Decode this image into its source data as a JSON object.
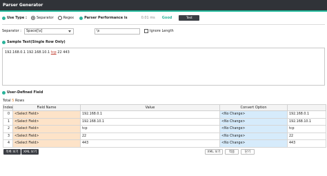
{
  "window": {
    "title": "Parser Generator"
  },
  "use_type": {
    "label": "Use Type :",
    "options": [
      {
        "label": "Separator",
        "checked": true
      },
      {
        "label": "Regex",
        "checked": false
      }
    ]
  },
  "performance": {
    "label": "Parser Performance is",
    "value": "0.01 ms",
    "status": "Good",
    "test_label": "Test"
  },
  "separator": {
    "label": "Separator :",
    "selected": "Space[\\s]",
    "input_value": "\\s",
    "ignore_length_label": "Ignore Length"
  },
  "sample": {
    "label": "Sample Text(Single Row Only)",
    "text_before": "192.168.0.1 192.168.10.1 ",
    "text_highlight": "tcp",
    "text_after": " 22 443"
  },
  "user_defined": {
    "label": "User-Defined Field",
    "total_prefix": "Total ",
    "total_count": "5",
    "total_suffix": " Rows",
    "columns": [
      "Index",
      "Field Name",
      "Value",
      "Convert Option",
      ""
    ],
    "rows": [
      [
        "0",
        "<Select Field>",
        "192.168.0.1",
        "<No Change>",
        "192.168.0.1"
      ],
      [
        "1",
        "<Select Field>",
        "192.168.10.1",
        "<No Change>",
        "192.168.10.1"
      ],
      [
        "2",
        "<Select Field>",
        "tcp",
        "<No Change>",
        "tcp"
      ],
      [
        "3",
        "<Select Field>",
        "22",
        "<No Change>",
        "22"
      ],
      [
        "4",
        "<Select Field>",
        "443",
        "<No Change>",
        "443"
      ]
    ]
  },
  "buttons": {
    "save_config": "목록 보기",
    "xml_view": "XML 보기",
    "xml_save": "XML 보기",
    "apply": "적용",
    "close": "닫기"
  },
  "colors": {
    "accent": "#2ab39a",
    "field_name_bg": "#fde3c8",
    "convert_bg": "#d6ebfb",
    "titlebar": "#303338"
  }
}
